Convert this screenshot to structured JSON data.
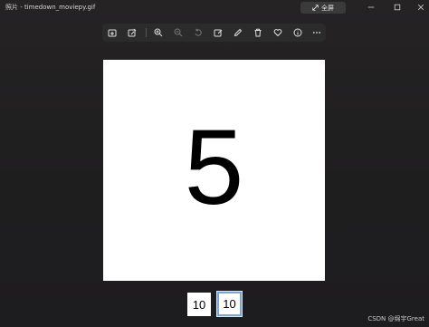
{
  "window": {
    "title": "照片 - timedown_moviepy.gif",
    "fullscreen_label": "全屏",
    "icons": [
      "minimize-icon",
      "maximize-icon",
      "close-icon"
    ]
  },
  "toolbar": {
    "items": [
      {
        "name": "add-to-album-icon"
      },
      {
        "name": "enhance-icon"
      },
      {
        "name": "zoom-in-icon"
      },
      {
        "name": "zoom-out-icon"
      },
      {
        "name": "rotate-icon"
      },
      {
        "name": "crop-edit-icon"
      },
      {
        "name": "draw-icon"
      },
      {
        "name": "delete-icon"
      },
      {
        "name": "favorite-icon"
      },
      {
        "name": "info-icon"
      },
      {
        "name": "more-icon"
      }
    ]
  },
  "image": {
    "frame_text": "5"
  },
  "filmstrip": {
    "frames": [
      "10",
      "10"
    ],
    "selected_index": 1
  },
  "watermark": "CSDN @绵宇Great"
}
